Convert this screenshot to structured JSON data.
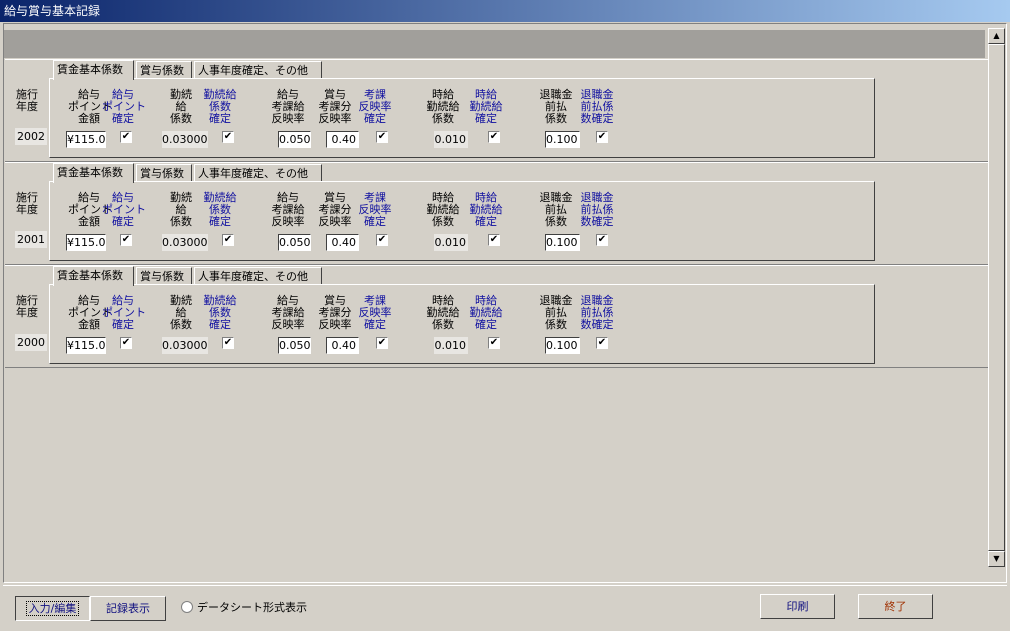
{
  "window": {
    "title": "給与賞与基本記録"
  },
  "tabs": [
    "賃金基本係数",
    "賞与係数",
    "人事年度確定、その他"
  ],
  "labels": {
    "year": "施行\n年度",
    "point_amount": "給与\nポイント\n金額",
    "point_confirm": "給与\nポイント\n確定",
    "service": "勤続\n給\n係数",
    "service_confirm": "勤続給\n係数\n確定",
    "eval_rate": "給与\n考課給\n反映率",
    "bonus_eval": "賞与\n考課分\n反映率",
    "eval_confirm": "考課\n反映率\n確定",
    "hourly": "時給\n勤続給\n係数",
    "hourly_confirm": "時給\n勤続給\n確定",
    "retire": "退職金\n前払\n係数",
    "retire_confirm": "退職金\n前払係\n数確定"
  },
  "records": [
    {
      "year": "2002",
      "point_amount": "¥115.0",
      "service": "0.03000",
      "eval_rate": "0.050",
      "bonus_eval": "0.40",
      "hourly": "0.010",
      "retire": "0.100",
      "check_mark": "✔"
    },
    {
      "year": "2001",
      "point_amount": "¥115.0",
      "service": "0.03000",
      "eval_rate": "0.050",
      "bonus_eval": "0.40",
      "hourly": "0.010",
      "retire": "0.100",
      "check_mark": "✔"
    },
    {
      "year": "2000",
      "point_amount": "¥115.0",
      "service": "0.03000",
      "eval_rate": "0.050",
      "bonus_eval": "0.40",
      "hourly": "0.010",
      "retire": "0.100",
      "check_mark": "✔"
    }
  ],
  "footer": {
    "input_edit": "入力/編集",
    "show_records": "記録表示",
    "datasheet_view": "データシート形式表示",
    "print": "印刷",
    "exit": "終了"
  },
  "scroll": {
    "up": "▲",
    "down": "▼"
  },
  "colors": {
    "title_start": "#0a246a",
    "title_end": "#a6caf0",
    "label_blue": "#1010a0",
    "exit_text": "#a03000",
    "print_text": "#101080"
  }
}
